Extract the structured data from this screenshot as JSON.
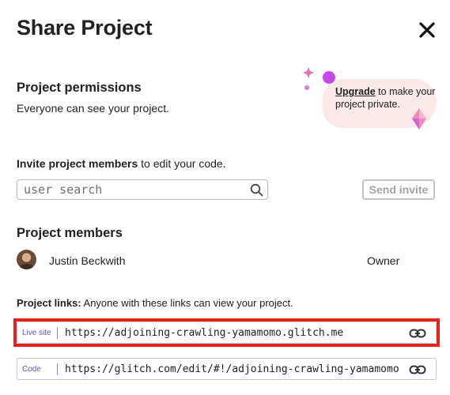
{
  "dialog": {
    "title": "Share Project",
    "close_icon": "close-icon"
  },
  "permissions": {
    "heading": "Project permissions",
    "description": "Everyone can see your project.",
    "upgrade_link": "Upgrade",
    "upgrade_text": " to make your project private."
  },
  "invite": {
    "label_bold": "Invite project members",
    "label_rest": " to edit your code.",
    "search_placeholder": "user search",
    "search_icon": "search-icon",
    "send_label": "Send invite"
  },
  "members": {
    "heading": "Project members",
    "list": [
      {
        "name": "Justin Beckwith",
        "role": "Owner"
      }
    ]
  },
  "links": {
    "label_bold": "Project links:",
    "label_rest": " Anyone with these links can view your project.",
    "items": [
      {
        "type": "Live site",
        "url": "https://adjoining-crawling-yamamomo.glitch.me",
        "icon": "link-icon"
      },
      {
        "type": "Code",
        "url": "https://glitch.com/edit/#!/adjoining-crawling-yamamomo",
        "icon": "link-icon"
      }
    ]
  },
  "colors": {
    "highlight": "#e3261c",
    "link_type": "#6a4fc3",
    "upgrade_blob": "#fbe9ea",
    "decor_purple": "#c04be8",
    "decor_pink": "#e56fb2"
  }
}
